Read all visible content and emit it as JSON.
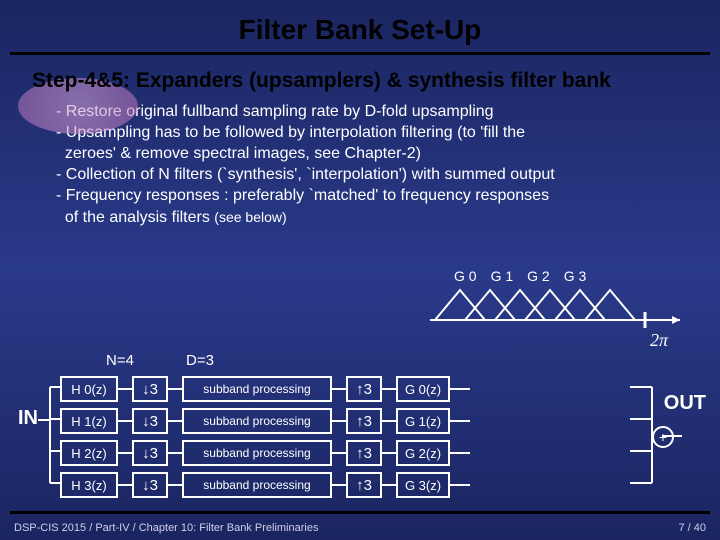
{
  "title": "Filter Bank Set-Up",
  "subtitle": "Step-4&5: Expanders (upsamplers) & synthesis filter bank",
  "bullets": [
    "- Restore original fullband sampling rate by D-fold upsampling",
    "- Upsampling has to be followed by interpolation filtering (to 'fill the",
    "  zeroes' & remove spectral images, see Chapter-2)",
    "- Collection of N filters (`synthesis', `interpolation') with summed output",
    "- Frequency responses : preferably `matched' to frequency responses",
    "  of the analysis filters"
  ],
  "see_below": "(see below)",
  "freq_labels": [
    "G 0",
    "G 1",
    "G 2",
    "G 3"
  ],
  "two_pi": "2π",
  "nd": {
    "n": "N=4",
    "d": "D=3"
  },
  "io": {
    "in": "IN",
    "out": "OUT"
  },
  "rows": [
    {
      "h": "H 0(z)",
      "d": "↓3",
      "s": "subband processing",
      "u": "↑3",
      "g": "G 0(z)"
    },
    {
      "h": "H 1(z)",
      "d": "↓3",
      "s": "subband processing",
      "u": "↑3",
      "g": "G 1(z)"
    },
    {
      "h": "H 2(z)",
      "d": "↓3",
      "s": "subband processing",
      "u": "↑3",
      "g": "G 2(z)"
    },
    {
      "h": "H 3(z)",
      "d": "↓3",
      "s": "subband processing",
      "u": "↑3",
      "g": "G 3(z)"
    }
  ],
  "plus": "+",
  "footer": {
    "left": "DSP-CIS 2015 / Part-IV / Chapter 10: Filter Bank Preliminaries",
    "right": "7 / 40"
  },
  "chart_data": {
    "type": "line",
    "title": "Frequency responses of synthesis filters G0…G3",
    "x_range": [
      0,
      "2π"
    ],
    "series": [
      {
        "name": "G0",
        "shape": "triangle",
        "center_over_2pi": 0.0
      },
      {
        "name": "G1",
        "shape": "triangle",
        "center_over_2pi": 0.25
      },
      {
        "name": "G2",
        "shape": "triangle",
        "center_over_2pi": 0.5
      },
      {
        "name": "G3",
        "shape": "triangle",
        "center_over_2pi": 0.75
      }
    ]
  }
}
